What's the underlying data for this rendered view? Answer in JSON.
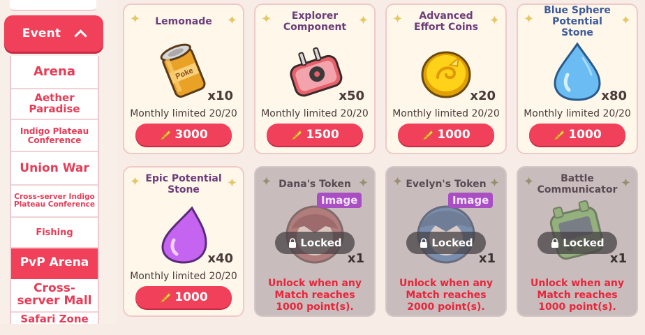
{
  "sidebar": {
    "event_label": "Event",
    "items": [
      {
        "label": "Arena"
      },
      {
        "label": "Aether Paradise"
      },
      {
        "label": "Indigo Plateau Conference"
      },
      {
        "label": "Union War"
      },
      {
        "label": "Cross-server Indigo Plateau Conference"
      },
      {
        "label": "Fishing"
      },
      {
        "label": "PvP Arena"
      },
      {
        "label": "Cross-server Mall"
      },
      {
        "label": "Safari Zone"
      }
    ],
    "active_index": 6
  },
  "colors": {
    "accent": "#f0405a",
    "locked_text": "#e8263b"
  },
  "shop": {
    "items": [
      {
        "name": "Lemonade",
        "icon": "lemonade-can-icon",
        "quantity": "x10",
        "limit": "Monthly limited 20/20",
        "price": "3000"
      },
      {
        "name": "Explorer Component",
        "icon": "explorer-component-icon",
        "quantity": "x50",
        "limit": "Monthly limited 20/20",
        "price": "1500"
      },
      {
        "name": "Advanced Effort Coins",
        "icon": "effort-coin-icon",
        "quantity": "x20",
        "limit": "Monthly limited 20/20",
        "price": "1000"
      },
      {
        "name": "Blue Sphere Potential Stone",
        "icon": "blue-stone-icon",
        "quantity": "x80",
        "limit": "Monthly limited 20/20",
        "price": "1000"
      },
      {
        "name": "Epic Potential Stone",
        "icon": "purple-stone-icon",
        "quantity": "x40",
        "limit": "Monthly limited 20/20",
        "price": "1000"
      },
      {
        "name": "Dana's Token",
        "icon": "dana-token-icon",
        "quantity": "x1",
        "image_tag": "Image",
        "locked_label": "Locked",
        "unlock": "Unlock when any Match reaches 1000 point(s)."
      },
      {
        "name": "Evelyn's Token",
        "icon": "evelyn-token-icon",
        "quantity": "x1",
        "image_tag": "Image",
        "locked_label": "Locked",
        "unlock": "Unlock when any Match reaches 2000 point(s)."
      },
      {
        "name": "Battle Communicator",
        "icon": "battle-communicator-icon",
        "quantity": "x1",
        "locked_label": "Locked",
        "unlock": "Unlock when any Match reaches 1000 point(s)."
      }
    ]
  }
}
